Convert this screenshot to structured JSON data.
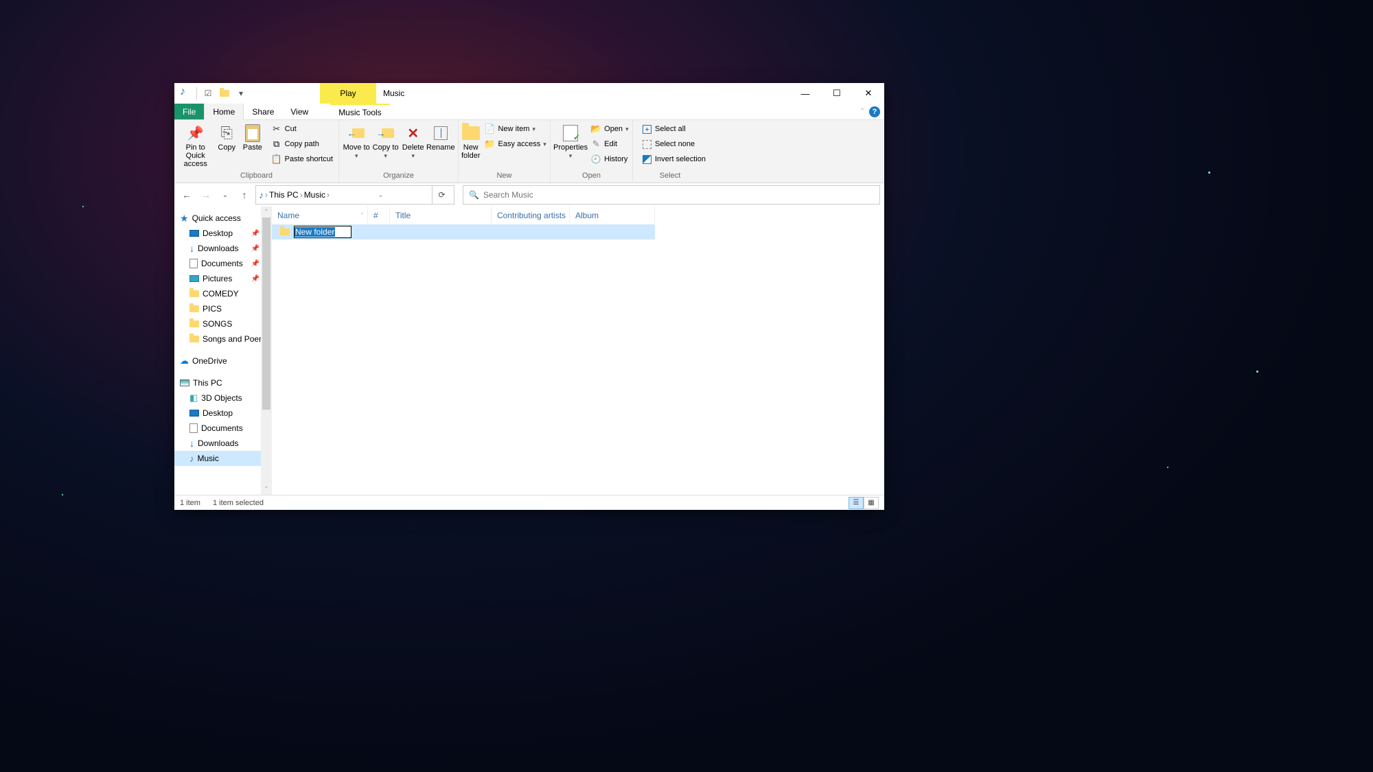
{
  "title": "Music",
  "play_tab": "Play",
  "tabs": {
    "file": "File",
    "home": "Home",
    "share": "Share",
    "view": "View",
    "music_tools": "Music Tools"
  },
  "ribbon": {
    "clipboard": {
      "label": "Clipboard",
      "pin": "Pin to Quick access",
      "copy": "Copy",
      "paste": "Paste",
      "cut": "Cut",
      "copypath": "Copy path",
      "pasteshortcut": "Paste shortcut"
    },
    "organize": {
      "label": "Organize",
      "moveto": "Move to",
      "copyto": "Copy to",
      "delete": "Delete",
      "rename": "Rename"
    },
    "new": {
      "label": "New",
      "newfolder": "New folder",
      "newitem": "New item",
      "easyaccess": "Easy access"
    },
    "open": {
      "label": "Open",
      "properties": "Properties",
      "open": "Open",
      "edit": "Edit",
      "history": "History"
    },
    "select": {
      "label": "Select",
      "selectall": "Select all",
      "selectnone": "Select none",
      "invert": "Invert selection"
    }
  },
  "breadcrumb": {
    "thispc": "This PC",
    "music": "Music"
  },
  "search_placeholder": "Search Music",
  "sidebar": {
    "quickaccess": "Quick access",
    "qa_items": [
      {
        "label": "Desktop",
        "icon": "desktop",
        "pinned": true
      },
      {
        "label": "Downloads",
        "icon": "dl",
        "pinned": true
      },
      {
        "label": "Documents",
        "icon": "doc",
        "pinned": true
      },
      {
        "label": "Pictures",
        "icon": "pic",
        "pinned": true
      },
      {
        "label": "COMEDY",
        "icon": "fld"
      },
      {
        "label": "PICS",
        "icon": "fld"
      },
      {
        "label": "SONGS",
        "icon": "fld"
      },
      {
        "label": "Songs and Poem",
        "icon": "fld"
      }
    ],
    "onedrive": "OneDrive",
    "thispc": "This PC",
    "pc_items": [
      {
        "label": "3D Objects",
        "icon": "3d"
      },
      {
        "label": "Desktop",
        "icon": "desktop"
      },
      {
        "label": "Documents",
        "icon": "doc"
      },
      {
        "label": "Downloads",
        "icon": "dl"
      },
      {
        "label": "Music",
        "icon": "music",
        "selected": true
      }
    ]
  },
  "columns": {
    "name": "Name",
    "num": "#",
    "title": "Title",
    "artists": "Contributing artists",
    "album": "Album"
  },
  "file_row": {
    "rename_value": "New folder"
  },
  "status": {
    "count": "1 item",
    "selected": "1 item selected"
  }
}
